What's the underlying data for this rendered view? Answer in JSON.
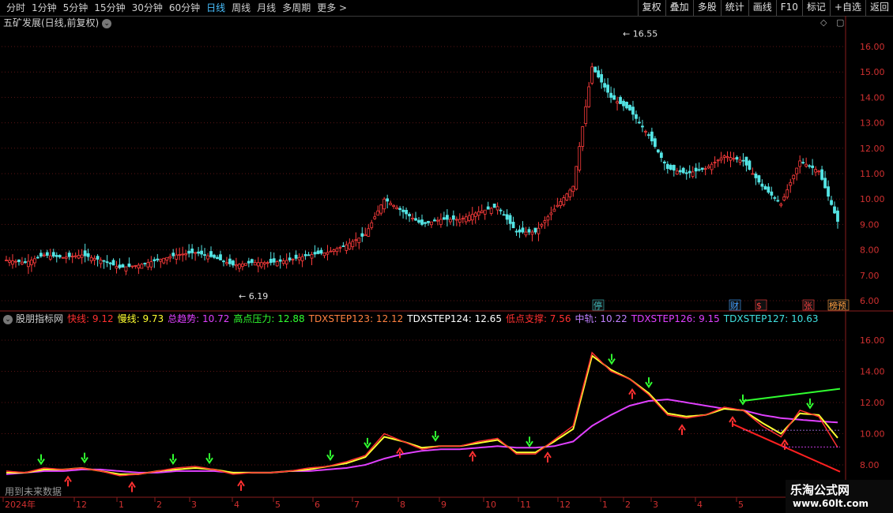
{
  "toolbar": {
    "periods": [
      "分时",
      "1分钟",
      "5分钟",
      "15分钟",
      "30分钟",
      "60分钟",
      "日线",
      "周线",
      "月线",
      "多周期",
      "更多 >"
    ],
    "active_index": 6,
    "buttons": [
      "复权",
      "叠加",
      "多股",
      "统计",
      "画线",
      "F10",
      "标记",
      "+自选",
      "返回"
    ]
  },
  "main": {
    "title": "五矿发展(日线,前复权)",
    "y_ticks": [
      "16.00",
      "15.00",
      "14.00",
      "13.00",
      "12.00",
      "11.00",
      "10.00",
      "9.00",
      "8.00",
      "7.00",
      "6.00"
    ],
    "high_label": "16.55",
    "low_label": "6.19",
    "markers": [
      "停",
      "财",
      "$",
      "张",
      "榜预"
    ]
  },
  "indicator": {
    "name": "股朋指标网",
    "legend": [
      {
        "label": "快线: 9.12",
        "color": "#ff3030"
      },
      {
        "label": "慢线: 9.73",
        "color": "#ffff30"
      },
      {
        "label": "总趋势: 10.72",
        "color": "#e040ff"
      },
      {
        "label": "高点压力: 12.88",
        "color": "#30ff30"
      },
      {
        "label": "TDXSTEP123: 12.12",
        "color": "#ff8040"
      },
      {
        "label": "TDXSTEP124: 12.65",
        "color": "#ffffff"
      },
      {
        "label": "低点支撑: 7.56",
        "color": "#ff3030"
      },
      {
        "label": "中轨: 10.22",
        "color": "#c080ff"
      },
      {
        "label": "TDXSTEP126: 9.15",
        "color": "#e040ff"
      },
      {
        "label": "TDXSTEP127: 10.63",
        "color": "#40e0e0"
      }
    ],
    "y_ticks": [
      "16.00",
      "14.00",
      "12.00",
      "10.00",
      "8.00"
    ],
    "no_future": "用到未来数据"
  },
  "time_axis": [
    "2024年",
    "12",
    "1",
    "2",
    "3",
    "4",
    "5",
    "6",
    "7",
    "8",
    "9",
    "10",
    "11",
    "12",
    "1",
    "2",
    "3",
    "4",
    "5"
  ],
  "watermark": {
    "line1": "乐淘公式网",
    "line2": "www.60lt.com"
  },
  "chart_data": {
    "type": "line",
    "title": "五矿发展(日线,前复权)",
    "main_ylim": [
      6,
      16.55
    ],
    "series": [
      {
        "name": "快线",
        "values": [
          7.6,
          7.5,
          7.8,
          7.7,
          7.8,
          7.6,
          7.3,
          7.4,
          7.6,
          7.8,
          7.9,
          7.7,
          7.4,
          7.5,
          7.5,
          7.6,
          7.8,
          7.9,
          8.2,
          8.6,
          10.0,
          9.5,
          9.0,
          9.2,
          9.2,
          9.5,
          9.7,
          8.7,
          8.7,
          9.6,
          10.5,
          15.2,
          14.0,
          13.5,
          12.5,
          11.2,
          11.0,
          11.2,
          11.7,
          11.5,
          10.5,
          9.8,
          11.5,
          11.1,
          9.12
        ]
      },
      {
        "name": "慢线",
        "values": [
          7.5,
          7.5,
          7.7,
          7.7,
          7.8,
          7.6,
          7.4,
          7.4,
          7.6,
          7.7,
          7.8,
          7.7,
          7.5,
          7.5,
          7.5,
          7.6,
          7.7,
          7.9,
          8.1,
          8.5,
          9.8,
          9.5,
          9.1,
          9.2,
          9.2,
          9.4,
          9.6,
          8.8,
          8.8,
          9.5,
          10.3,
          15.0,
          14.1,
          13.5,
          12.6,
          11.3,
          11.1,
          11.2,
          11.6,
          11.5,
          10.7,
          10.0,
          11.3,
          11.2,
          9.73
        ]
      },
      {
        "name": "总趋势",
        "values": [
          7.4,
          7.5,
          7.6,
          7.6,
          7.7,
          7.7,
          7.6,
          7.5,
          7.5,
          7.6,
          7.6,
          7.6,
          7.5,
          7.5,
          7.5,
          7.6,
          7.6,
          7.7,
          7.8,
          8.0,
          8.4,
          8.7,
          8.9,
          9.0,
          9.0,
          9.1,
          9.2,
          9.1,
          9.1,
          9.2,
          9.5,
          10.5,
          11.2,
          11.8,
          12.1,
          12.2,
          12.0,
          11.8,
          11.6,
          11.5,
          11.2,
          11.0,
          10.9,
          10.8,
          10.72
        ]
      }
    ]
  }
}
